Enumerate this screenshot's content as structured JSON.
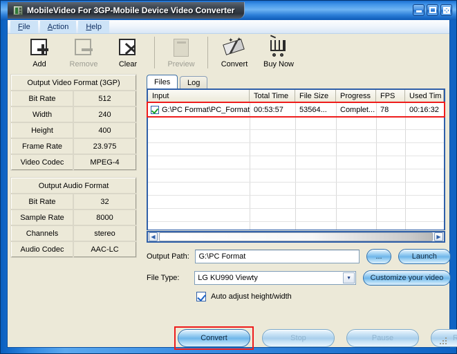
{
  "window": {
    "title": "MobileVideo For 3GP-Mobile Device Video Converter",
    "app_icon": "app-icon",
    "minimize_label": "Minimize",
    "maximize_label": "Maximize",
    "close_label": "Close"
  },
  "menu": {
    "items": [
      {
        "label": "File",
        "accel": "F",
        "rest": "ile"
      },
      {
        "label": "Action",
        "accel": "A",
        "rest": "ction"
      },
      {
        "label": "Help",
        "accel": "H",
        "rest": "elp"
      }
    ]
  },
  "toolbar": {
    "buttons": [
      {
        "label": "Add",
        "icon": "add-document-icon",
        "enabled": true
      },
      {
        "label": "Remove",
        "icon": "remove-document-icon",
        "enabled": false
      },
      {
        "label": "Clear",
        "icon": "clear-document-icon",
        "enabled": true
      },
      {
        "label": "Preview",
        "icon": "preview-icon",
        "enabled": false
      },
      {
        "label": "Convert",
        "icon": "magic-wand-icon",
        "enabled": true
      },
      {
        "label": "Buy Now",
        "icon": "shopping-cart-icon",
        "enabled": true
      }
    ]
  },
  "video_format": {
    "title": "Output Video Format (3GP)",
    "rows": [
      {
        "key": "Bit Rate",
        "value": "512"
      },
      {
        "key": "Width",
        "value": "240"
      },
      {
        "key": "Height",
        "value": "400"
      },
      {
        "key": "Frame Rate",
        "value": "23.975"
      },
      {
        "key": "Video Codec",
        "value": "MPEG-4"
      }
    ]
  },
  "audio_format": {
    "title": "Output Audio Format",
    "rows": [
      {
        "key": "Bit Rate",
        "value": "32"
      },
      {
        "key": "Sample Rate",
        "value": "8000"
      },
      {
        "key": "Channels",
        "value": "stereo"
      },
      {
        "key": "Audio Codec",
        "value": "AAC-LC"
      }
    ]
  },
  "tabs": [
    {
      "label": "Files",
      "active": true
    },
    {
      "label": "Log",
      "active": false
    }
  ],
  "file_list": {
    "columns": [
      "Input",
      "Total Time",
      "File Size",
      "Progress",
      "FPS",
      "Used Tim"
    ],
    "rows": [
      {
        "checked": true,
        "input": "G:\\PC Format\\PC_Format...",
        "total_time": "00:53:57",
        "file_size": "53564...",
        "progress": "Complet...",
        "fps": "78",
        "used_time": "00:16:32"
      }
    ]
  },
  "scrollbar": {
    "left_arrow": "◀",
    "right_arrow": "▶"
  },
  "form": {
    "output_path_label": "Output Path:",
    "output_path_value": "G:\\PC Format",
    "browse_label": "...",
    "launch_label": "Launch",
    "file_type_label": "File Type:",
    "file_type_value": "LG KU990 Viewty",
    "customize_label": "Customize your video",
    "auto_adjust_label": "Auto adjust height/width",
    "auto_adjust_checked": true
  },
  "actions": [
    {
      "label": "Convert",
      "enabled": true,
      "highlighted": true
    },
    {
      "label": "Stop",
      "enabled": false,
      "highlighted": false
    },
    {
      "label": "Pause",
      "enabled": false,
      "highlighted": false
    },
    {
      "label": "Resume",
      "enabled": false,
      "highlighted": false
    }
  ],
  "colors": {
    "highlight_red": "#ee1c1c",
    "titlebar_blue": "#2d7fd8",
    "client_beige": "#ece9d8"
  }
}
